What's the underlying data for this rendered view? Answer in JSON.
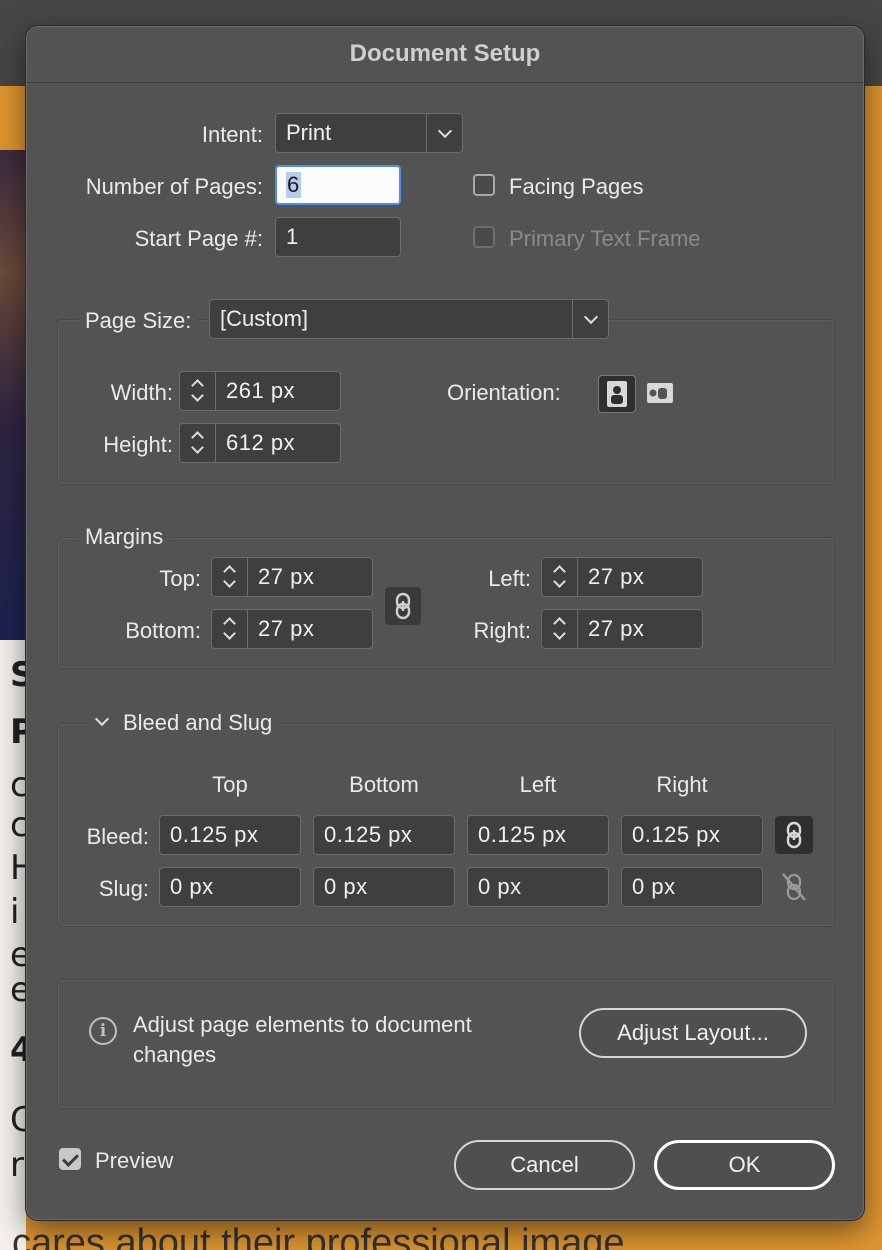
{
  "dialog": {
    "title": "Document Setup"
  },
  "intent": {
    "label": "Intent:",
    "value": "Print"
  },
  "pages": {
    "number_label": "Number of Pages:",
    "number_value": "6",
    "start_label": "Start Page #:",
    "start_value": "1"
  },
  "checkboxes": {
    "facing_pages": {
      "label": "Facing Pages",
      "checked": false
    },
    "primary_text_frame": {
      "label": "Primary Text Frame",
      "checked": false,
      "enabled": false
    }
  },
  "page_size": {
    "label": "Page Size:",
    "value": "[Custom]",
    "width_label": "Width:",
    "width_value": "261 px",
    "height_label": "Height:",
    "height_value": "612 px",
    "orientation_label": "Orientation:",
    "orientation": "portrait"
  },
  "margins": {
    "legend": "Margins",
    "top_label": "Top:",
    "top_value": "27 px",
    "bottom_label": "Bottom:",
    "bottom_value": "27 px",
    "left_label": "Left:",
    "left_value": "27 px",
    "right_label": "Right:",
    "right_value": "27 px"
  },
  "bleed_slug": {
    "legend": "Bleed and Slug",
    "headers": [
      "Top",
      "Bottom",
      "Left",
      "Right"
    ],
    "bleed_label": "Bleed:",
    "bleed_values": [
      "0.125 px",
      "0.125 px",
      "0.125 px",
      "0.125 px"
    ],
    "slug_label": "Slug:",
    "slug_values": [
      "0 px",
      "0 px",
      "0 px",
      "0 px"
    ]
  },
  "adjust": {
    "text_line1": "Adjust page elements to document",
    "text_line2": "changes",
    "button": "Adjust Layout..."
  },
  "footer": {
    "preview_label": "Preview",
    "preview_checked": true,
    "cancel": "Cancel",
    "ok": "OK"
  },
  "background": {
    "bottom_text": "cares about their professional image",
    "left_letters": [
      "S",
      "P",
      "c",
      "c",
      "H",
      "i",
      "e",
      "e",
      "4",
      "C",
      "r"
    ]
  },
  "colors": {
    "dialog_bg": "#535353",
    "accent_focus": "#4a8ff0",
    "backdrop": "#dd9530"
  }
}
